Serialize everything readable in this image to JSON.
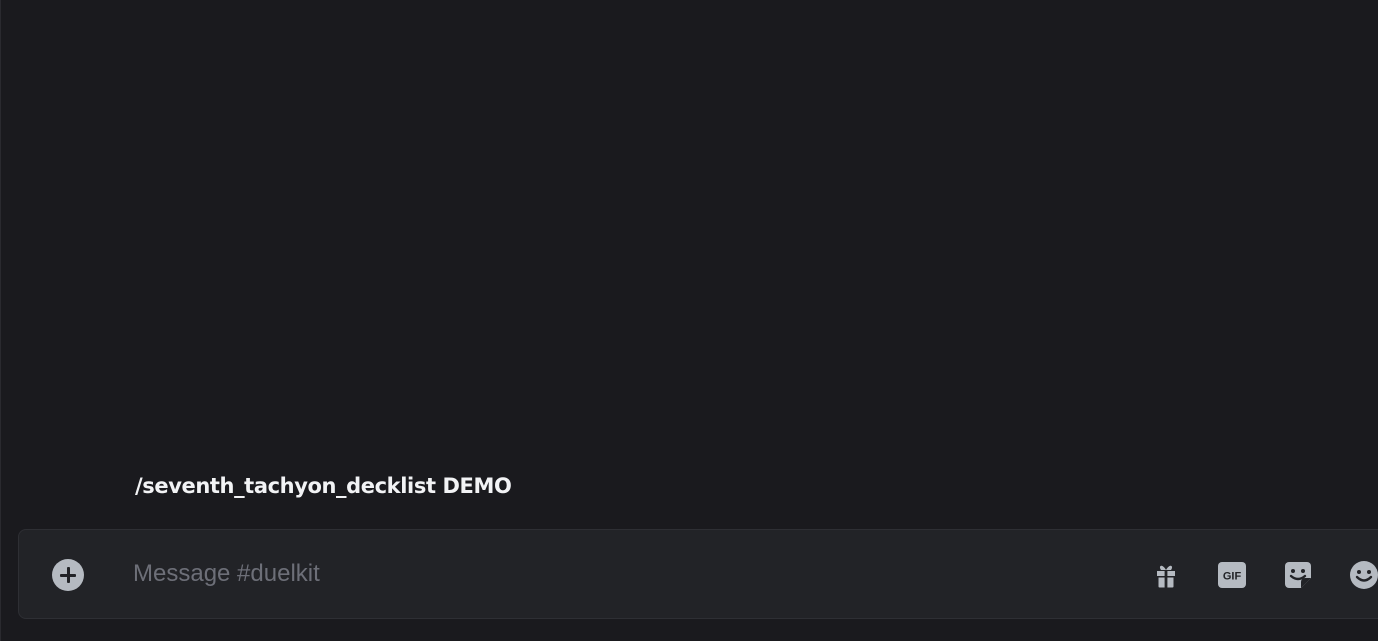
{
  "chat": {
    "message_text": "/seventh_tachyon_decklist DEMO"
  },
  "composer": {
    "placeholder": "Message #duelkit",
    "value": "",
    "icons": {
      "attach": "plus-circle-icon",
      "gift": "gift-icon",
      "gif": "gif-icon",
      "sticker": "sticker-icon",
      "emoji": "emoji-icon"
    },
    "gif_label": "GIF"
  },
  "colors": {
    "background": "#1a1a1e",
    "composer_bg": "#222327",
    "icon": "#b5bac1",
    "text": "#f2f3f5",
    "placeholder": "#6d6f78"
  }
}
